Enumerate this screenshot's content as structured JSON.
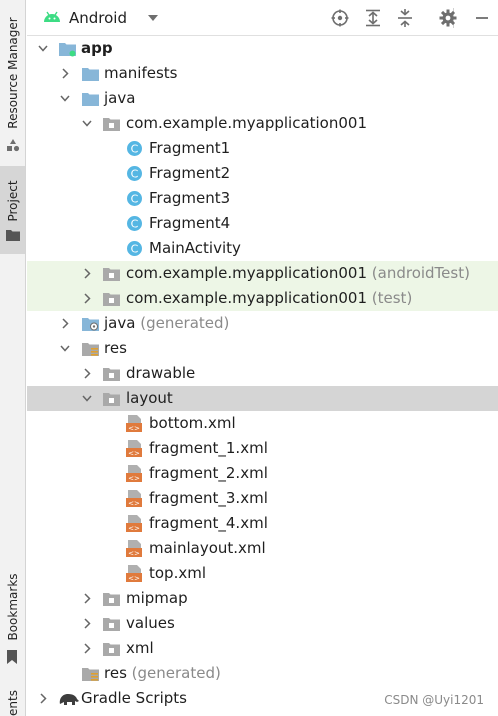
{
  "sidebar": {
    "resource_manager": "Resource Manager",
    "project": "Project",
    "bookmarks": "Bookmarks",
    "bottom_partial": "ents"
  },
  "toolbar": {
    "title": "Android",
    "icons": [
      "android-icon",
      "dropdown-icon",
      "locate-icon",
      "expand-all-icon",
      "collapse-all-icon",
      "settings-icon",
      "minimize-icon"
    ]
  },
  "tree": {
    "app": "app",
    "manifests": "manifests",
    "java": "java",
    "pkg_main": "com.example.myapplication001",
    "fragment1": "Fragment1",
    "fragment2": "Fragment2",
    "fragment3": "Fragment3",
    "fragment4": "Fragment4",
    "main_activity": "MainActivity",
    "pkg_android_test": "com.example.myapplication001",
    "pkg_android_test_suffix": "(androidTest)",
    "pkg_test": "com.example.myapplication001",
    "pkg_test_suffix": "(test)",
    "java_generated": "java",
    "java_generated_suffix": "(generated)",
    "res": "res",
    "drawable": "drawable",
    "layout": "layout",
    "layout_files": [
      "bottom.xml",
      "fragment_1.xml",
      "fragment_2.xml",
      "fragment_3.xml",
      "fragment_4.xml",
      "mainlayout.xml",
      "top.xml"
    ],
    "mipmap": "mipmap",
    "values": "values",
    "xml": "xml",
    "res_generated": "res",
    "res_generated_suffix": "(generated)",
    "gradle_scripts": "Gradle Scripts"
  },
  "watermark": "CSDN @Uyi1201",
  "colors": {
    "folder": "#87b6d8",
    "class_circle": "#55b6e3",
    "xml_icon": "#e07a3c",
    "green_row": "#edf6e6",
    "selected_row": "#d5d5d5",
    "android_green": "#3ddc84"
  }
}
